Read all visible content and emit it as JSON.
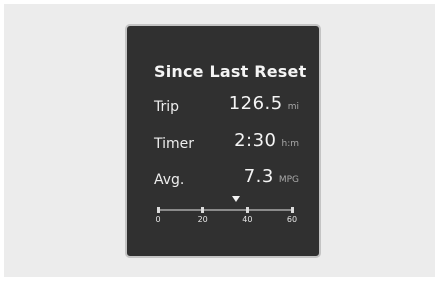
{
  "panel": {
    "title": "Since Last Reset",
    "rows": [
      {
        "label": "Trip",
        "value": "126.5",
        "unit": "mi"
      },
      {
        "label": "Timer",
        "value": "2:30",
        "unit": "h:m"
      },
      {
        "label": "Avg.",
        "value": "7.3",
        "unit": "MPG"
      }
    ],
    "scale": {
      "ticks": [
        "0",
        "20",
        "40",
        "60"
      ],
      "min": 0,
      "max": 60,
      "pointer_value": 35
    }
  }
}
